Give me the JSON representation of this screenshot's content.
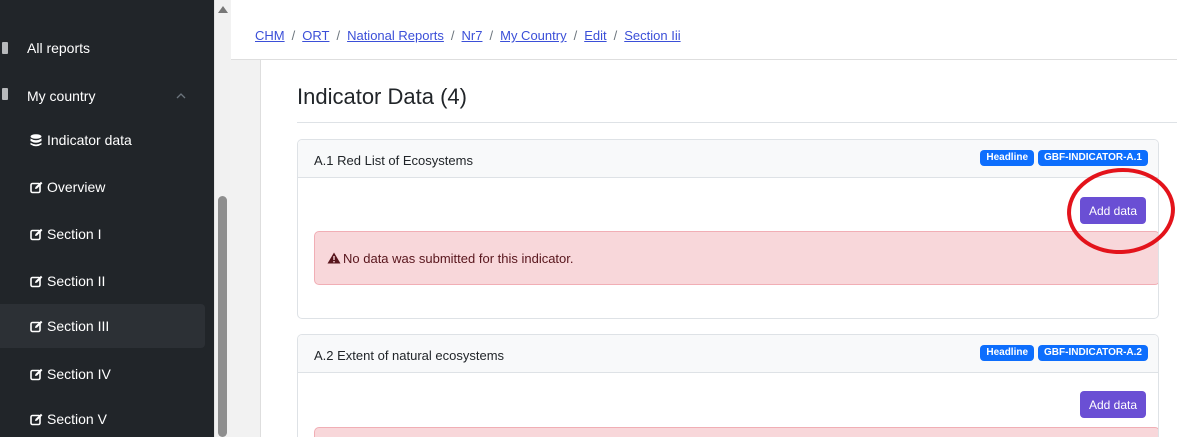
{
  "sidebar": {
    "items": [
      {
        "label": "All reports",
        "icon": "list-icon"
      },
      {
        "label": "My country",
        "icon": "book-icon"
      },
      {
        "label": "Indicator data",
        "icon": "database-icon"
      },
      {
        "label": "Overview",
        "icon": "edit-icon"
      },
      {
        "label": "Section I",
        "icon": "edit-icon"
      },
      {
        "label": "Section II",
        "icon": "edit-icon"
      },
      {
        "label": "Section III",
        "icon": "edit-icon",
        "active": true
      },
      {
        "label": "Section IV",
        "icon": "edit-icon"
      },
      {
        "label": "Section V",
        "icon": "edit-icon"
      }
    ]
  },
  "breadcrumb": [
    "CHM",
    "ORT",
    "National Reports",
    "Nr7",
    "My Country",
    "Edit",
    "Section Iii"
  ],
  "main": {
    "title": "Indicator Data (4)",
    "cards": [
      {
        "title": "A.1 Red List of Ecosystems",
        "badges": [
          "Headline",
          "GBF-INDICATOR-A.1"
        ],
        "button": "Add data",
        "alert": "No data was submitted for this indicator."
      },
      {
        "title": "A.2 Extent of natural ecosystems",
        "badges": [
          "Headline",
          "GBF-INDICATOR-A.2"
        ],
        "button": "Add data",
        "alert": ""
      }
    ]
  },
  "colors": {
    "sidebar_bg": "#212529",
    "badge": "#0d6efd",
    "button": "#6a4fd4",
    "alert_bg": "#f8d7da",
    "annotation": "#e3131b"
  }
}
